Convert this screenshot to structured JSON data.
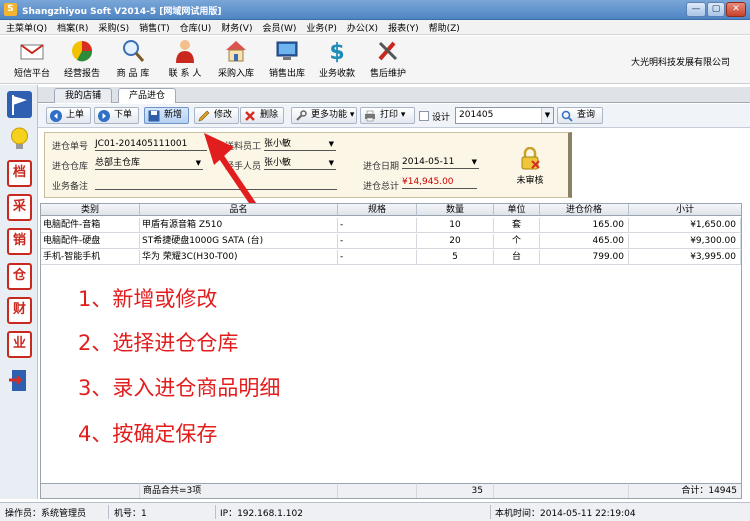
{
  "window": {
    "title": "Shangzhiyou Soft V2014-5 [网域网试用版]",
    "minimize": "—",
    "maximize": "▢",
    "close": "✕"
  },
  "menu": [
    "主菜单(Q)",
    "档案(R)",
    "采购(S)",
    "销售(T)",
    "仓库(U)",
    "财务(V)",
    "会员(W)",
    "业务(P)",
    "办公(X)",
    "报表(Y)",
    "帮助(Z)"
  ],
  "toolbar": [
    {
      "label": "短信平台",
      "icon": "envelope-icon"
    },
    {
      "label": "经营报告",
      "icon": "pie-chart-icon"
    },
    {
      "label": "商 品 库",
      "icon": "magnifier-icon"
    },
    {
      "label": "联 系 人",
      "icon": "person-icon"
    },
    {
      "label": "采购入库",
      "icon": "house-icon"
    },
    {
      "label": "销售出库",
      "icon": "monitor-icon"
    },
    {
      "label": "业务收款",
      "icon": "dollar-icon"
    },
    {
      "label": "售后维护",
      "icon": "tools-icon"
    }
  ],
  "company": "大光明科技发展有限公司",
  "sidebar": [
    "flag-icon",
    "bulb-icon",
    "档",
    "采",
    "销",
    "仓",
    "财",
    "业",
    "exit-icon"
  ],
  "tabs": [
    "我的店铺",
    "产品进仓"
  ],
  "actions": {
    "prev": "上单",
    "next": "下单",
    "new": "新增",
    "edit": "修改",
    "delete": "删除",
    "more": "更多功能",
    "print": "打印",
    "design": "设计",
    "period": "201405",
    "query": "查询"
  },
  "form": {
    "order_no_label": "进仓单号",
    "order_no": "JC01-201405111001",
    "deliverer_label": "送料员工",
    "deliverer": "张小敏",
    "warehouse_label": "进仓仓库",
    "warehouse": "总部主仓库",
    "handler_label": "经手人员",
    "handler": "张小敏",
    "date_label": "进仓日期",
    "date": "2014-05-11",
    "remark_label": "业务备注",
    "remark": "",
    "total_label": "进仓总计",
    "total": "¥14,945.00",
    "audit_label": "未审核"
  },
  "grid": {
    "headers": [
      "类别",
      "品名",
      "规格",
      "数量",
      "单位",
      "进仓价格",
      "小计"
    ],
    "rows": [
      [
        "电脑配件-音箱",
        "甲盾有源音箱 Z510",
        "-",
        "10",
        "套",
        "165.00",
        "¥1,650.00"
      ],
      [
        "电脑配件-硬盘",
        "ST希捷硬盘1000G SATA (台)",
        "-",
        "20",
        "个",
        "465.00",
        "¥9,300.00"
      ],
      [
        "手机-智能手机",
        "华为 荣耀3C(H30-T00)",
        "-",
        "5",
        "台",
        "799.00",
        "¥3,995.00"
      ]
    ],
    "footer": {
      "count": "商品合共=3项",
      "qty": "35",
      "total": "合计：14945"
    }
  },
  "annotations": [
    "1、新增或修改",
    "2、选择进仓仓库",
    "3、录入进仓商品明细",
    "4、按确定保存"
  ],
  "status": {
    "operator": "操作员：系统管理员",
    "machine": "机号：1",
    "ip": "IP：192.168.1.102",
    "time": "本机时间：2014-05-11 22:19:04"
  },
  "colors": {
    "annotation": "#e21d1d",
    "form_bg": "#fbf6e6",
    "title_bar": "#4f84c4"
  }
}
